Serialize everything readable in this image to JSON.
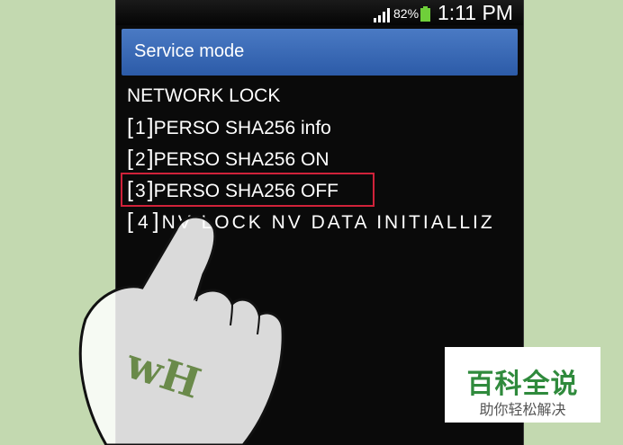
{
  "status_bar": {
    "battery_percent": "82%",
    "time": "1:11 PM",
    "icons": [
      "signal-icon",
      "battery-icon"
    ]
  },
  "titlebar": {
    "title": "Service mode"
  },
  "menu": {
    "header": "NETWORK LOCK",
    "items": [
      {
        "index": "1",
        "label": "PERSO SHA256 info"
      },
      {
        "index": "2",
        "label": "PERSO SHA256 ON"
      },
      {
        "index": "3",
        "label": "PERSO SHA256 OFF"
      },
      {
        "index": "4",
        "label": "NV LOCK NV DATA INITIALLIZ"
      }
    ],
    "highlighted_index": "3"
  },
  "hand_logo": "wH",
  "watermark": {
    "title": "百科全说",
    "subtitle": "助你轻松解决"
  },
  "colors": {
    "background": "#c3d9b0",
    "titlebar": "#2c5ba8",
    "highlight": "#d0223a",
    "watermark_title": "#2f8a3c"
  }
}
